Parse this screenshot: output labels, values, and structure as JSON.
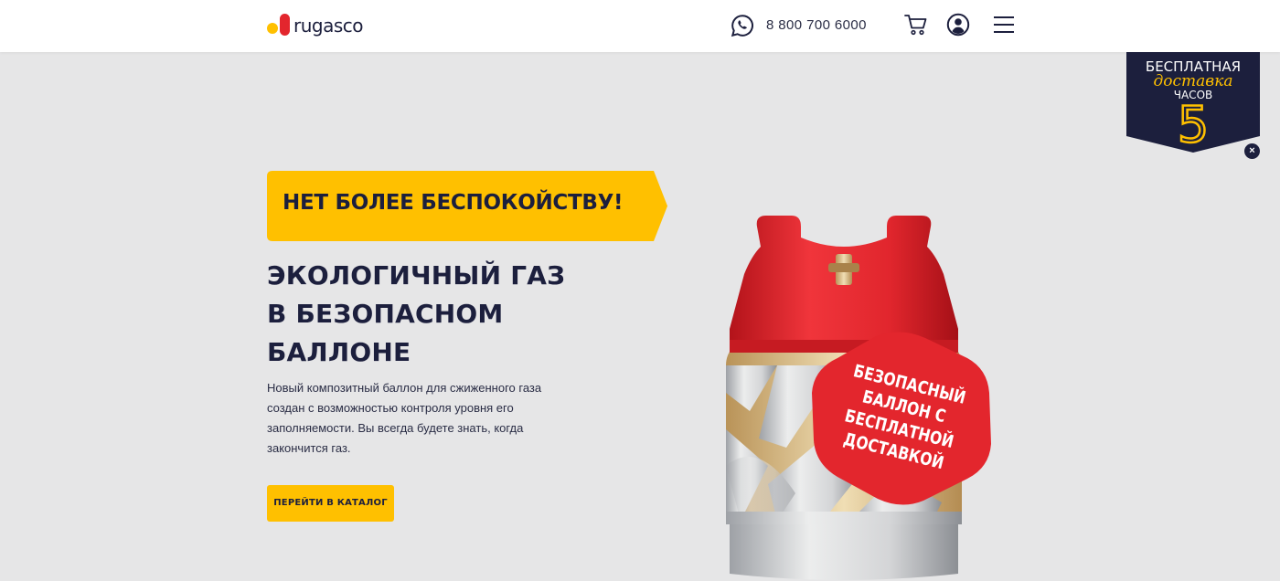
{
  "brand": {
    "name": "rugasco",
    "colors": {
      "primary": "#1c1f3d",
      "accent": "#ffc000",
      "red": "#e3262d"
    }
  },
  "header": {
    "phone": "8 800 700 6000",
    "icons": [
      "whatsapp-icon",
      "cart-icon",
      "user-icon",
      "menu-icon"
    ]
  },
  "badge": {
    "line1": "БЕСПЛАТНАЯ",
    "line2": "доставка",
    "line3": "ЧАСОВ",
    "number": "5",
    "close": "×"
  },
  "hero": {
    "tag": "НЕТ БОЛЕЕ БЕСПОКОЙСТВУ!",
    "headline": [
      "ЭКОЛОГИЧНЫЙ ГАЗ",
      "В БЕЗОПАСНОМ",
      "БАЛЛОНЕ"
    ],
    "description": "Новый композитный баллон для сжиженного газа создан с возможностью контроля уровня его заполняемости. Вы всегда будете знать, когда закончится газ.",
    "cta": "ПЕРЕЙТИ В КАТАЛОГ"
  },
  "product": {
    "promo": [
      "БЕЗОПАСНЫЙ",
      "БАЛЛОН С",
      "БЕСПЛАТНОЙ",
      "ДОСТАВКОЙ"
    ]
  }
}
